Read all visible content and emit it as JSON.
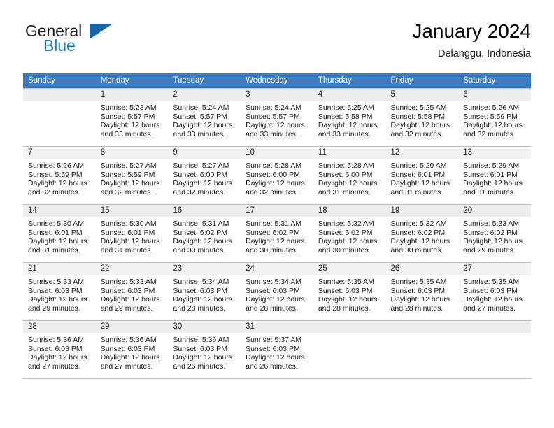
{
  "brand": {
    "word_one": "General",
    "word_two": "Blue",
    "flag_icon": "triangle-flag-icon"
  },
  "header": {
    "title": "January 2024",
    "location": "Delanggu, Indonesia"
  },
  "colors": {
    "header_blue": "#3b7dc0",
    "brand_blue": "#1f7cc2",
    "flag_blue": "#1565a8",
    "daynum_band": "#f2f2f2",
    "grid_line": "#bfbfbf"
  },
  "weekdays": [
    "Sunday",
    "Monday",
    "Tuesday",
    "Wednesday",
    "Thursday",
    "Friday",
    "Saturday"
  ],
  "weeks": [
    [
      {
        "day": "",
        "sunrise": "",
        "sunset": "",
        "daylight_a": "",
        "daylight_b": ""
      },
      {
        "day": "1",
        "sunrise": "Sunrise: 5:23 AM",
        "sunset": "Sunset: 5:57 PM",
        "daylight_a": "Daylight: 12 hours",
        "daylight_b": "and 33 minutes."
      },
      {
        "day": "2",
        "sunrise": "Sunrise: 5:24 AM",
        "sunset": "Sunset: 5:57 PM",
        "daylight_a": "Daylight: 12 hours",
        "daylight_b": "and 33 minutes."
      },
      {
        "day": "3",
        "sunrise": "Sunrise: 5:24 AM",
        "sunset": "Sunset: 5:57 PM",
        "daylight_a": "Daylight: 12 hours",
        "daylight_b": "and 33 minutes."
      },
      {
        "day": "4",
        "sunrise": "Sunrise: 5:25 AM",
        "sunset": "Sunset: 5:58 PM",
        "daylight_a": "Daylight: 12 hours",
        "daylight_b": "and 33 minutes."
      },
      {
        "day": "5",
        "sunrise": "Sunrise: 5:25 AM",
        "sunset": "Sunset: 5:58 PM",
        "daylight_a": "Daylight: 12 hours",
        "daylight_b": "and 32 minutes."
      },
      {
        "day": "6",
        "sunrise": "Sunrise: 5:26 AM",
        "sunset": "Sunset: 5:59 PM",
        "daylight_a": "Daylight: 12 hours",
        "daylight_b": "and 32 minutes."
      }
    ],
    [
      {
        "day": "7",
        "sunrise": "Sunrise: 5:26 AM",
        "sunset": "Sunset: 5:59 PM",
        "daylight_a": "Daylight: 12 hours",
        "daylight_b": "and 32 minutes."
      },
      {
        "day": "8",
        "sunrise": "Sunrise: 5:27 AM",
        "sunset": "Sunset: 5:59 PM",
        "daylight_a": "Daylight: 12 hours",
        "daylight_b": "and 32 minutes."
      },
      {
        "day": "9",
        "sunrise": "Sunrise: 5:27 AM",
        "sunset": "Sunset: 6:00 PM",
        "daylight_a": "Daylight: 12 hours",
        "daylight_b": "and 32 minutes."
      },
      {
        "day": "10",
        "sunrise": "Sunrise: 5:28 AM",
        "sunset": "Sunset: 6:00 PM",
        "daylight_a": "Daylight: 12 hours",
        "daylight_b": "and 32 minutes."
      },
      {
        "day": "11",
        "sunrise": "Sunrise: 5:28 AM",
        "sunset": "Sunset: 6:00 PM",
        "daylight_a": "Daylight: 12 hours",
        "daylight_b": "and 31 minutes."
      },
      {
        "day": "12",
        "sunrise": "Sunrise: 5:29 AM",
        "sunset": "Sunset: 6:01 PM",
        "daylight_a": "Daylight: 12 hours",
        "daylight_b": "and 31 minutes."
      },
      {
        "day": "13",
        "sunrise": "Sunrise: 5:29 AM",
        "sunset": "Sunset: 6:01 PM",
        "daylight_a": "Daylight: 12 hours",
        "daylight_b": "and 31 minutes."
      }
    ],
    [
      {
        "day": "14",
        "sunrise": "Sunrise: 5:30 AM",
        "sunset": "Sunset: 6:01 PM",
        "daylight_a": "Daylight: 12 hours",
        "daylight_b": "and 31 minutes."
      },
      {
        "day": "15",
        "sunrise": "Sunrise: 5:30 AM",
        "sunset": "Sunset: 6:01 PM",
        "daylight_a": "Daylight: 12 hours",
        "daylight_b": "and 31 minutes."
      },
      {
        "day": "16",
        "sunrise": "Sunrise: 5:31 AM",
        "sunset": "Sunset: 6:02 PM",
        "daylight_a": "Daylight: 12 hours",
        "daylight_b": "and 30 minutes."
      },
      {
        "day": "17",
        "sunrise": "Sunrise: 5:31 AM",
        "sunset": "Sunset: 6:02 PM",
        "daylight_a": "Daylight: 12 hours",
        "daylight_b": "and 30 minutes."
      },
      {
        "day": "18",
        "sunrise": "Sunrise: 5:32 AM",
        "sunset": "Sunset: 6:02 PM",
        "daylight_a": "Daylight: 12 hours",
        "daylight_b": "and 30 minutes."
      },
      {
        "day": "19",
        "sunrise": "Sunrise: 5:32 AM",
        "sunset": "Sunset: 6:02 PM",
        "daylight_a": "Daylight: 12 hours",
        "daylight_b": "and 30 minutes."
      },
      {
        "day": "20",
        "sunrise": "Sunrise: 5:33 AM",
        "sunset": "Sunset: 6:02 PM",
        "daylight_a": "Daylight: 12 hours",
        "daylight_b": "and 29 minutes."
      }
    ],
    [
      {
        "day": "21",
        "sunrise": "Sunrise: 5:33 AM",
        "sunset": "Sunset: 6:03 PM",
        "daylight_a": "Daylight: 12 hours",
        "daylight_b": "and 29 minutes."
      },
      {
        "day": "22",
        "sunrise": "Sunrise: 5:33 AM",
        "sunset": "Sunset: 6:03 PM",
        "daylight_a": "Daylight: 12 hours",
        "daylight_b": "and 29 minutes."
      },
      {
        "day": "23",
        "sunrise": "Sunrise: 5:34 AM",
        "sunset": "Sunset: 6:03 PM",
        "daylight_a": "Daylight: 12 hours",
        "daylight_b": "and 28 minutes."
      },
      {
        "day": "24",
        "sunrise": "Sunrise: 5:34 AM",
        "sunset": "Sunset: 6:03 PM",
        "daylight_a": "Daylight: 12 hours",
        "daylight_b": "and 28 minutes."
      },
      {
        "day": "25",
        "sunrise": "Sunrise: 5:35 AM",
        "sunset": "Sunset: 6:03 PM",
        "daylight_a": "Daylight: 12 hours",
        "daylight_b": "and 28 minutes."
      },
      {
        "day": "26",
        "sunrise": "Sunrise: 5:35 AM",
        "sunset": "Sunset: 6:03 PM",
        "daylight_a": "Daylight: 12 hours",
        "daylight_b": "and 28 minutes."
      },
      {
        "day": "27",
        "sunrise": "Sunrise: 5:35 AM",
        "sunset": "Sunset: 6:03 PM",
        "daylight_a": "Daylight: 12 hours",
        "daylight_b": "and 27 minutes."
      }
    ],
    [
      {
        "day": "28",
        "sunrise": "Sunrise: 5:36 AM",
        "sunset": "Sunset: 6:03 PM",
        "daylight_a": "Daylight: 12 hours",
        "daylight_b": "and 27 minutes."
      },
      {
        "day": "29",
        "sunrise": "Sunrise: 5:36 AM",
        "sunset": "Sunset: 6:03 PM",
        "daylight_a": "Daylight: 12 hours",
        "daylight_b": "and 27 minutes."
      },
      {
        "day": "30",
        "sunrise": "Sunrise: 5:36 AM",
        "sunset": "Sunset: 6:03 PM",
        "daylight_a": "Daylight: 12 hours",
        "daylight_b": "and 26 minutes."
      },
      {
        "day": "31",
        "sunrise": "Sunrise: 5:37 AM",
        "sunset": "Sunset: 6:03 PM",
        "daylight_a": "Daylight: 12 hours",
        "daylight_b": "and 26 minutes."
      },
      {
        "day": "",
        "sunrise": "",
        "sunset": "",
        "daylight_a": "",
        "daylight_b": ""
      },
      {
        "day": "",
        "sunrise": "",
        "sunset": "",
        "daylight_a": "",
        "daylight_b": ""
      },
      {
        "day": "",
        "sunrise": "",
        "sunset": "",
        "daylight_a": "",
        "daylight_b": ""
      }
    ]
  ]
}
